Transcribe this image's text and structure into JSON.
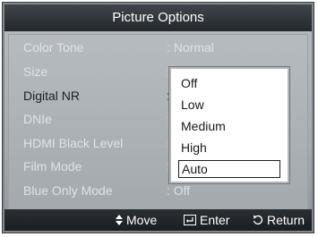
{
  "title": "Picture Options",
  "menu": [
    {
      "label": "Color Tone",
      "value": ": Normal",
      "active": false
    },
    {
      "label": "Size",
      "value": ":",
      "active": false
    },
    {
      "label": "Digital NR",
      "value": ":",
      "active": true
    },
    {
      "label": "DNIe",
      "value": ":",
      "active": false
    },
    {
      "label": "HDMI Black Level",
      "value": ":",
      "active": false
    },
    {
      "label": "Film Mode",
      "value": ":",
      "active": false
    },
    {
      "label": "Blue Only Mode",
      "value": ": Off",
      "active": false
    }
  ],
  "popup": {
    "options": [
      "Off",
      "Low",
      "Medium",
      "High",
      "Auto"
    ],
    "selected": "Auto"
  },
  "footer": {
    "move_label": "Move",
    "enter_label": "Enter",
    "return_label": "Return",
    "move_icon": "updown-arrows-icon",
    "enter_icon": "enter-icon",
    "return_icon": "return-icon"
  },
  "colors": {
    "title_bar": "#2e3338",
    "body": "#a7acb0",
    "text_dim": "#dfe3e6",
    "text_active": "#1c2024",
    "popup_bg": "#ffffff"
  }
}
